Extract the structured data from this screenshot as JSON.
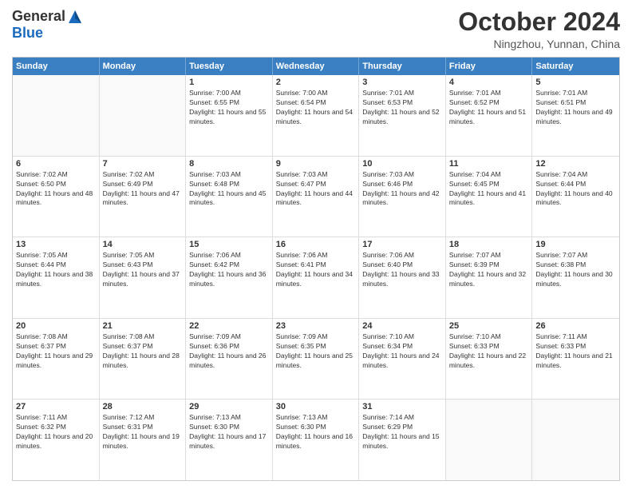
{
  "header": {
    "logo_general": "General",
    "logo_blue": "Blue",
    "title": "October 2024",
    "location": "Ningzhou, Yunnan, China"
  },
  "days_of_week": [
    "Sunday",
    "Monday",
    "Tuesday",
    "Wednesday",
    "Thursday",
    "Friday",
    "Saturday"
  ],
  "weeks": [
    [
      {
        "day": "",
        "text": ""
      },
      {
        "day": "",
        "text": ""
      },
      {
        "day": "1",
        "text": "Sunrise: 7:00 AM\nSunset: 6:55 PM\nDaylight: 11 hours and 55 minutes."
      },
      {
        "day": "2",
        "text": "Sunrise: 7:00 AM\nSunset: 6:54 PM\nDaylight: 11 hours and 54 minutes."
      },
      {
        "day": "3",
        "text": "Sunrise: 7:01 AM\nSunset: 6:53 PM\nDaylight: 11 hours and 52 minutes."
      },
      {
        "day": "4",
        "text": "Sunrise: 7:01 AM\nSunset: 6:52 PM\nDaylight: 11 hours and 51 minutes."
      },
      {
        "day": "5",
        "text": "Sunrise: 7:01 AM\nSunset: 6:51 PM\nDaylight: 11 hours and 49 minutes."
      }
    ],
    [
      {
        "day": "6",
        "text": "Sunrise: 7:02 AM\nSunset: 6:50 PM\nDaylight: 11 hours and 48 minutes."
      },
      {
        "day": "7",
        "text": "Sunrise: 7:02 AM\nSunset: 6:49 PM\nDaylight: 11 hours and 47 minutes."
      },
      {
        "day": "8",
        "text": "Sunrise: 7:03 AM\nSunset: 6:48 PM\nDaylight: 11 hours and 45 minutes."
      },
      {
        "day": "9",
        "text": "Sunrise: 7:03 AM\nSunset: 6:47 PM\nDaylight: 11 hours and 44 minutes."
      },
      {
        "day": "10",
        "text": "Sunrise: 7:03 AM\nSunset: 6:46 PM\nDaylight: 11 hours and 42 minutes."
      },
      {
        "day": "11",
        "text": "Sunrise: 7:04 AM\nSunset: 6:45 PM\nDaylight: 11 hours and 41 minutes."
      },
      {
        "day": "12",
        "text": "Sunrise: 7:04 AM\nSunset: 6:44 PM\nDaylight: 11 hours and 40 minutes."
      }
    ],
    [
      {
        "day": "13",
        "text": "Sunrise: 7:05 AM\nSunset: 6:44 PM\nDaylight: 11 hours and 38 minutes."
      },
      {
        "day": "14",
        "text": "Sunrise: 7:05 AM\nSunset: 6:43 PM\nDaylight: 11 hours and 37 minutes."
      },
      {
        "day": "15",
        "text": "Sunrise: 7:06 AM\nSunset: 6:42 PM\nDaylight: 11 hours and 36 minutes."
      },
      {
        "day": "16",
        "text": "Sunrise: 7:06 AM\nSunset: 6:41 PM\nDaylight: 11 hours and 34 minutes."
      },
      {
        "day": "17",
        "text": "Sunrise: 7:06 AM\nSunset: 6:40 PM\nDaylight: 11 hours and 33 minutes."
      },
      {
        "day": "18",
        "text": "Sunrise: 7:07 AM\nSunset: 6:39 PM\nDaylight: 11 hours and 32 minutes."
      },
      {
        "day": "19",
        "text": "Sunrise: 7:07 AM\nSunset: 6:38 PM\nDaylight: 11 hours and 30 minutes."
      }
    ],
    [
      {
        "day": "20",
        "text": "Sunrise: 7:08 AM\nSunset: 6:37 PM\nDaylight: 11 hours and 29 minutes."
      },
      {
        "day": "21",
        "text": "Sunrise: 7:08 AM\nSunset: 6:37 PM\nDaylight: 11 hours and 28 minutes."
      },
      {
        "day": "22",
        "text": "Sunrise: 7:09 AM\nSunset: 6:36 PM\nDaylight: 11 hours and 26 minutes."
      },
      {
        "day": "23",
        "text": "Sunrise: 7:09 AM\nSunset: 6:35 PM\nDaylight: 11 hours and 25 minutes."
      },
      {
        "day": "24",
        "text": "Sunrise: 7:10 AM\nSunset: 6:34 PM\nDaylight: 11 hours and 24 minutes."
      },
      {
        "day": "25",
        "text": "Sunrise: 7:10 AM\nSunset: 6:33 PM\nDaylight: 11 hours and 22 minutes."
      },
      {
        "day": "26",
        "text": "Sunrise: 7:11 AM\nSunset: 6:33 PM\nDaylight: 11 hours and 21 minutes."
      }
    ],
    [
      {
        "day": "27",
        "text": "Sunrise: 7:11 AM\nSunset: 6:32 PM\nDaylight: 11 hours and 20 minutes."
      },
      {
        "day": "28",
        "text": "Sunrise: 7:12 AM\nSunset: 6:31 PM\nDaylight: 11 hours and 19 minutes."
      },
      {
        "day": "29",
        "text": "Sunrise: 7:13 AM\nSunset: 6:30 PM\nDaylight: 11 hours and 17 minutes."
      },
      {
        "day": "30",
        "text": "Sunrise: 7:13 AM\nSunset: 6:30 PM\nDaylight: 11 hours and 16 minutes."
      },
      {
        "day": "31",
        "text": "Sunrise: 7:14 AM\nSunset: 6:29 PM\nDaylight: 11 hours and 15 minutes."
      },
      {
        "day": "",
        "text": ""
      },
      {
        "day": "",
        "text": ""
      }
    ]
  ]
}
